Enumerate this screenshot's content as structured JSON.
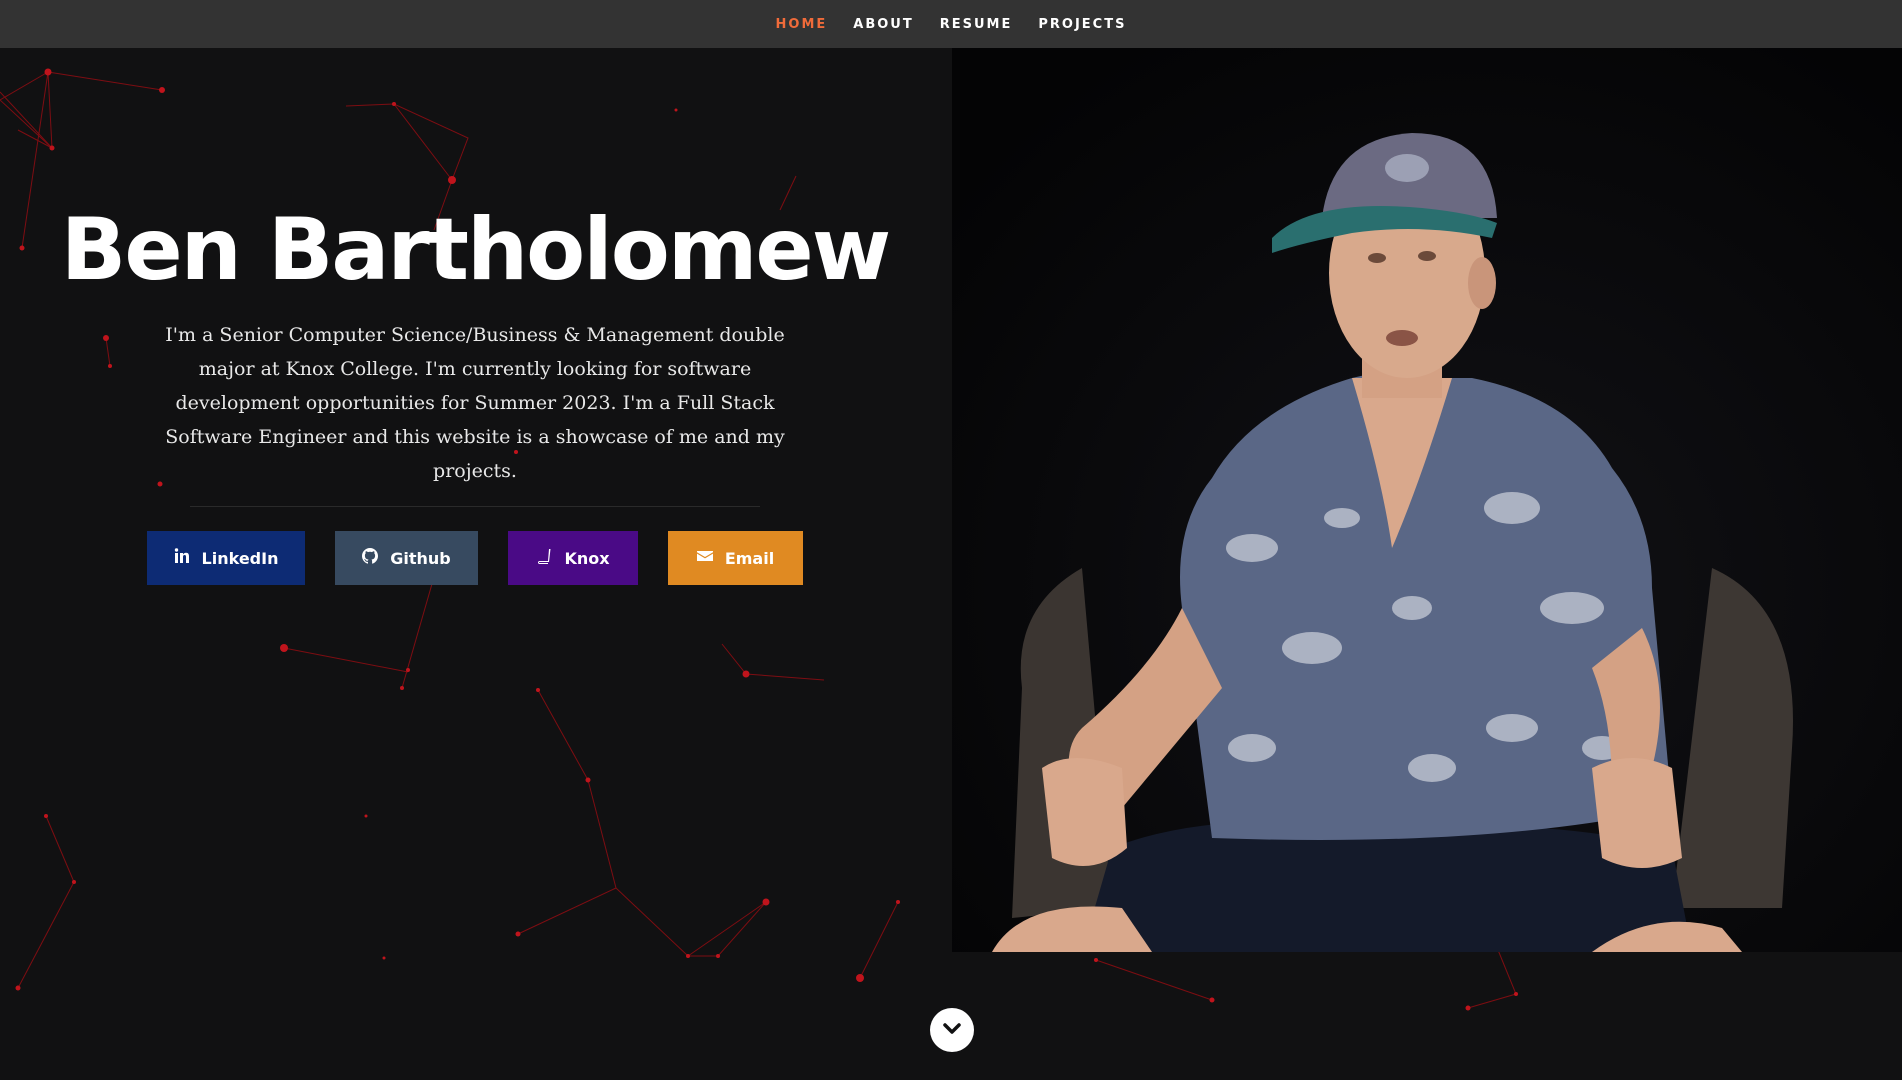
{
  "nav": {
    "items": [
      {
        "label": "HOME",
        "active": true
      },
      {
        "label": "ABOUT",
        "active": false
      },
      {
        "label": "RESUME",
        "active": false
      },
      {
        "label": "PROJECTS",
        "active": false
      }
    ],
    "active_color": "#f06b3a"
  },
  "hero": {
    "name": "Ben Bartholomew",
    "description": "I'm a Senior Computer Science/Business & Management double major at Knox College. I'm currently looking for software development opportunities for Summer 2023. I'm a Full Stack Software Engineer and this website is a showcase of me and my projects."
  },
  "buttons": {
    "linkedin": {
      "label": "LinkedIn",
      "icon": "linkedin-icon",
      "color": "#0d2b74"
    },
    "github": {
      "label": "Github",
      "icon": "github-icon",
      "color": "#374a60"
    },
    "knox": {
      "label": "Knox",
      "icon": "book-icon",
      "color": "#4a0a86"
    },
    "email": {
      "label": "Email",
      "icon": "envelope-icon",
      "color": "#e08a22"
    }
  },
  "scroll": {
    "icon": "chevron-down-icon"
  },
  "colors": {
    "background": "#111112",
    "nav_background": "#333333",
    "particle": "#c0141c"
  }
}
